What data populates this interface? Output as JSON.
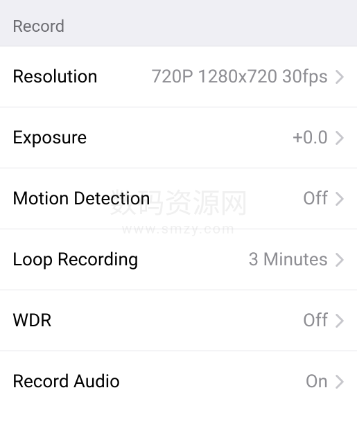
{
  "section": {
    "title": "Record"
  },
  "rows": [
    {
      "label": "Resolution",
      "value": "720P 1280x720 30fps"
    },
    {
      "label": "Exposure",
      "value": "+0.0"
    },
    {
      "label": "Motion Detection",
      "value": "Off"
    },
    {
      "label": "Loop Recording",
      "value": "3 Minutes"
    },
    {
      "label": "WDR",
      "value": "Off"
    },
    {
      "label": "Record Audio",
      "value": "On"
    }
  ],
  "watermark": {
    "main": "数码资源网",
    "sub": "www.smzy.com"
  }
}
